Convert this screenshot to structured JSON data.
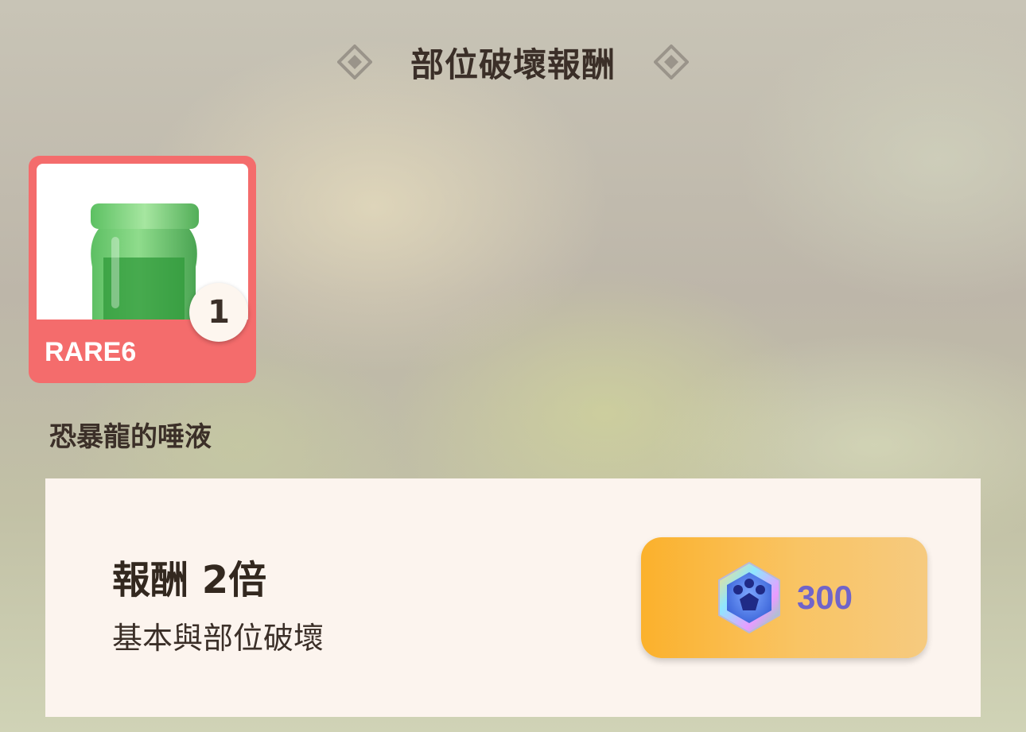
{
  "header": {
    "title": "部位破壞報酬",
    "left_icon": "diamond-ornament-icon",
    "right_icon": "diamond-ornament-icon"
  },
  "reward_item": {
    "rarity": "RARE6",
    "quantity": "1",
    "name": "恐暴龍的唾液",
    "icon": "green-jar-icon",
    "card_color": "#f46c6c"
  },
  "offer": {
    "title": "報酬 2倍",
    "subtitle": "基本與部位破壞",
    "price": "300",
    "currency_icon": "gem-icon",
    "button_color": "#fbb12c",
    "price_color": "#7064c9"
  }
}
